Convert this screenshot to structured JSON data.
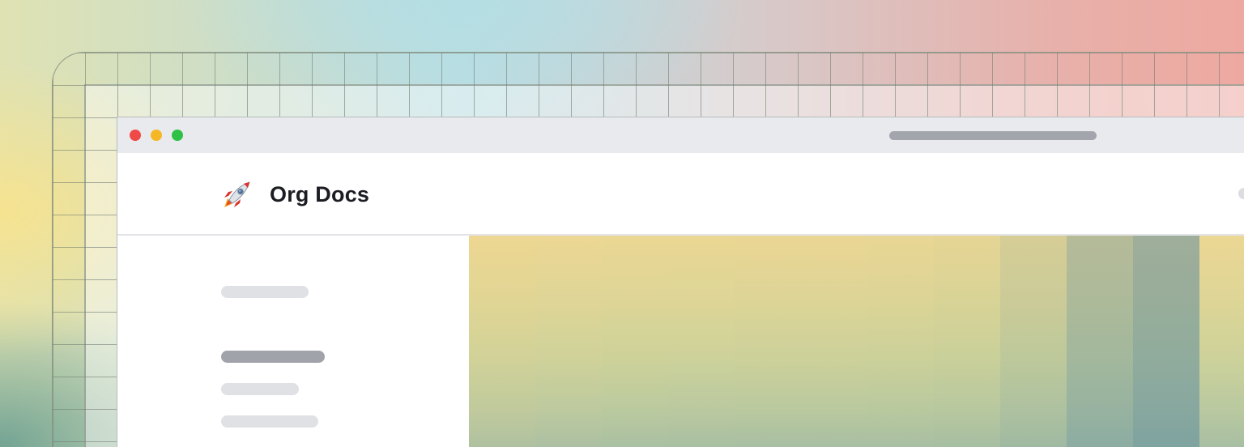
{
  "app": {
    "brand_name": "Org Docs",
    "logo_icon": "rocket-icon"
  },
  "window_controls": [
    "close",
    "minimize",
    "maximize"
  ],
  "colors": {
    "traffic_red": "#ef4a47",
    "traffic_yellow": "#f6b726",
    "traffic_green": "#2fc145",
    "placeholder_active": "#a1a3ab",
    "placeholder_inactive": "#e0e1e5"
  }
}
